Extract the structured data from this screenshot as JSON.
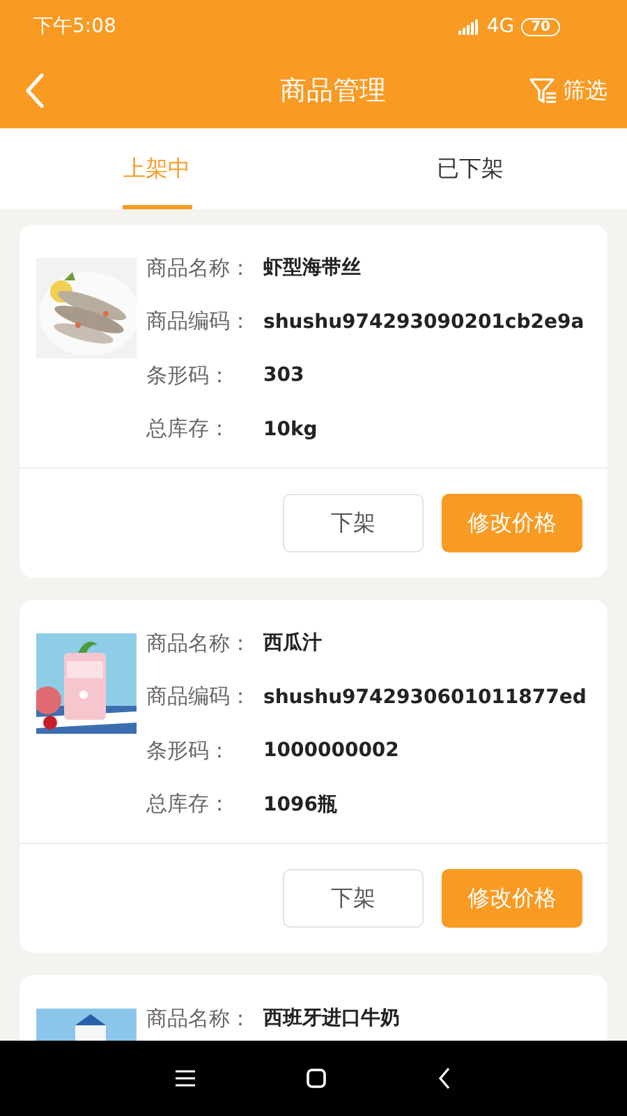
{
  "status_bar": {
    "time": "下午5:08",
    "network": "4G",
    "battery": "70"
  },
  "header": {
    "title": "商品管理",
    "filter_label": "筛选"
  },
  "tabs": [
    {
      "label": "上架中",
      "selected": true
    },
    {
      "label": "已下架",
      "selected": false
    }
  ],
  "products": [
    {
      "image": {
        "kind": "picture"
      },
      "fields": [
        {
          "label": "商品名称：",
          "value": "虾型海带丝"
        },
        {
          "label": "商品编码：",
          "value": "shushu974293090201cb2e9a"
        },
        {
          "label": "条形码：",
          "value": "303"
        },
        {
          "label": "总库存：",
          "value": "10kg"
        }
      ],
      "buttons": [
        {
          "label": "下架",
          "kind": "outline"
        },
        {
          "label": "修改价格",
          "kind": "primary"
        }
      ]
    },
    {
      "image": {
        "kind": "picture"
      },
      "fields": [
        {
          "label": "商品名称：",
          "value": "西瓜汁"
        },
        {
          "label": "商品编码：",
          "value": "shushu9742930601011877ed"
        },
        {
          "label": "条形码：",
          "value": "1000000002"
        },
        {
          "label": "总库存：",
          "value": "1096瓶"
        }
      ],
      "buttons": [
        {
          "label": "下架",
          "kind": "outline"
        },
        {
          "label": "修改价格",
          "kind": "primary"
        }
      ]
    },
    {
      "image": {
        "kind": "picture"
      },
      "fields": [
        {
          "label": "商品名称：",
          "value": "西班牙进口牛奶"
        }
      ]
    }
  ]
}
